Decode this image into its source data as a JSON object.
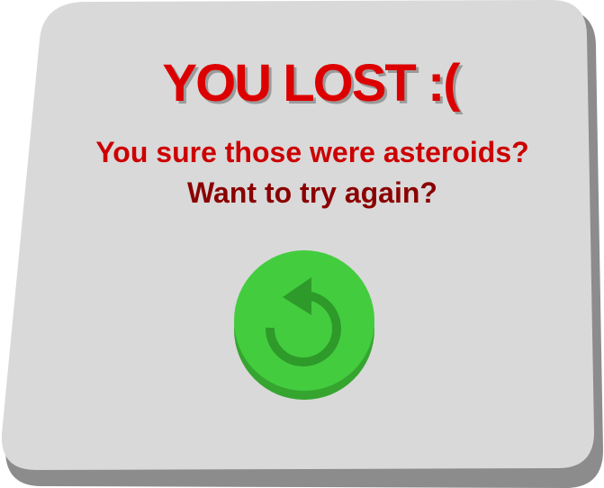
{
  "dialog": {
    "title": "YOU LOST :(",
    "message_line1": "You sure those were asteroids?",
    "message_line2": "Want to try again?"
  },
  "retry_button": {
    "icon": "retry-arrow-icon"
  },
  "colors": {
    "panel": "#d9d9d9",
    "panel_shadow": "#8c8c8c",
    "title": "#dd0000",
    "line1": "#cc0000",
    "line2": "#8a0000",
    "button_top": "#44cc3f",
    "button_side": "#36a530",
    "icon": "#2e9a2a"
  }
}
